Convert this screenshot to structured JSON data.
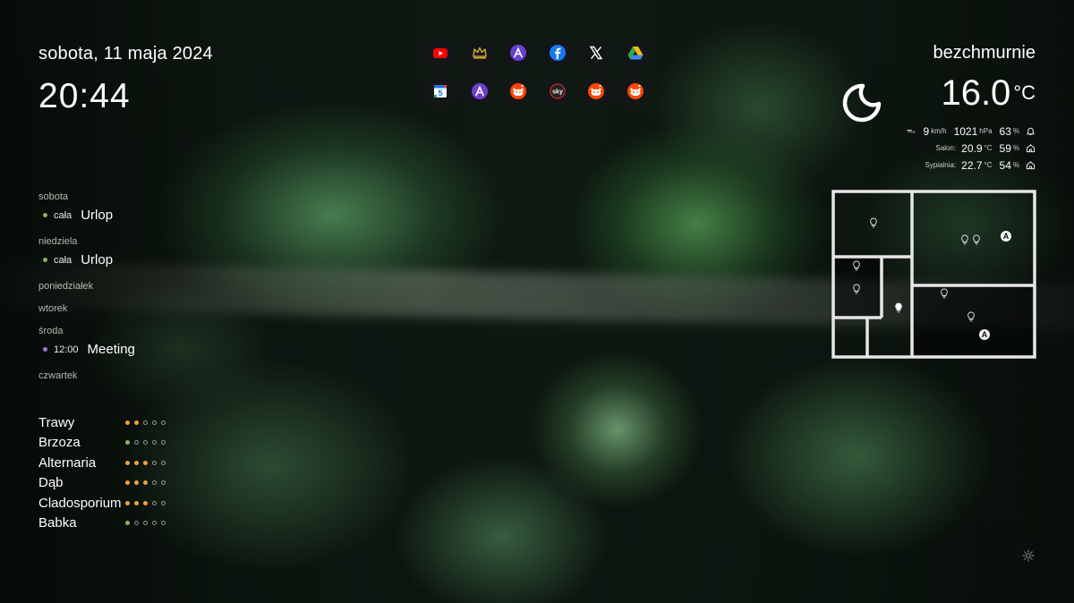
{
  "header": {
    "date": "sobota, 11 maja 2024",
    "time": "20:44"
  },
  "calendar": [
    {
      "day": "sobota",
      "events": [
        {
          "when": "cała",
          "title": "Urlop",
          "color": "#8db25e"
        }
      ]
    },
    {
      "day": "niedziela",
      "events": [
        {
          "when": "cała",
          "title": "Urlop",
          "color": "#8db25e"
        }
      ]
    },
    {
      "day": "poniedziałek",
      "events": []
    },
    {
      "day": "wtorek",
      "events": []
    },
    {
      "day": "środa",
      "events": [
        {
          "when": "12:00",
          "title": "Meeting",
          "color": "#9b7ad6"
        }
      ]
    },
    {
      "day": "czwartek",
      "events": []
    }
  ],
  "pollen": [
    {
      "name": "Trawy",
      "level": 2,
      "color": "#f0a040"
    },
    {
      "name": "Brzoza",
      "level": 1,
      "color": "#8db25e"
    },
    {
      "name": "Alternaria",
      "level": 3,
      "color": "#f0a040"
    },
    {
      "name": "Dąb",
      "level": 3,
      "color": "#f0a040"
    },
    {
      "name": "Cladosporium",
      "level": 3,
      "color": "#f0a040"
    },
    {
      "name": "Babka",
      "level": 1,
      "color": "#8db25e"
    }
  ],
  "apps": [
    {
      "icon": "youtube-icon"
    },
    {
      "icon": "crown-icon"
    },
    {
      "icon": "arc-icon"
    },
    {
      "icon": "facebook-icon"
    },
    {
      "icon": "x-icon"
    },
    {
      "icon": "google-drive-icon"
    },
    {
      "icon": "calendar-5-icon",
      "text": "5"
    },
    {
      "icon": "arc-icon"
    },
    {
      "icon": "reddit-icon"
    },
    {
      "icon": "sky-go-icon",
      "text": "sky"
    },
    {
      "icon": "reddit-icon"
    },
    {
      "icon": "reddit-icon"
    }
  ],
  "weather": {
    "condition": "bezchmurnie",
    "temperature": "16.0",
    "temperature_unit": "°C",
    "icon": "moon-icon",
    "wind_speed": "9",
    "wind_unit": "km/h",
    "pressure": "1021",
    "pressure_unit": "hPa",
    "humidity": "63",
    "humidity_unit": "%",
    "rooms": [
      {
        "label": "Salon:",
        "temperature": "20.9",
        "unit": "°C",
        "humidity": "59",
        "humidity_unit": "%"
      },
      {
        "label": "Sypialnia:",
        "temperature": "22.7",
        "unit": "°C",
        "humidity": "54",
        "humidity_unit": "%"
      }
    ]
  },
  "floorplan": {
    "auto_label": "A"
  }
}
